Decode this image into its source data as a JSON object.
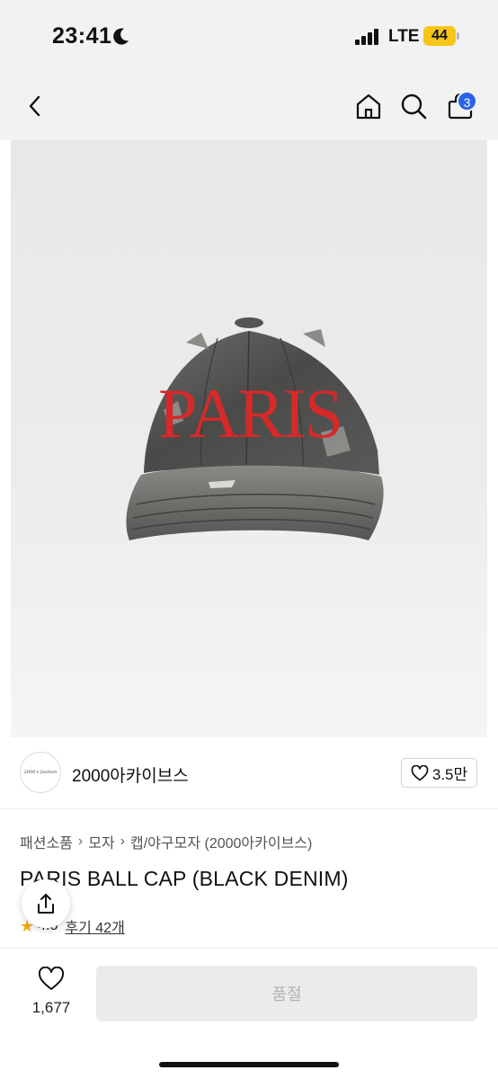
{
  "status": {
    "time": "23:41",
    "network": "LTE",
    "battery": "44"
  },
  "nav": {
    "cart_count": "3",
    "icons": [
      "back-icon",
      "home-icon",
      "search-icon",
      "cart-icon"
    ]
  },
  "product_image": {
    "embroidery_text": "PARIS"
  },
  "brand": {
    "logo_text": "2000's fashion",
    "name": "2000아카이브스",
    "likes": "3.5만"
  },
  "breadcrumb": [
    "패션소품",
    "모자",
    "캡/야구모자 (2000아카이브스)"
  ],
  "product": {
    "title": "PARIS BALL CAP (BLACK DENIM)",
    "rating": "4.8",
    "reviews": "후기 42개"
  },
  "action_bar": {
    "wish_count": "1,677",
    "buy_label": "품절"
  },
  "colors": {
    "accent_badge": "#2a63e6",
    "star": "#f3a712",
    "disabled_button": "#ebebeb"
  }
}
